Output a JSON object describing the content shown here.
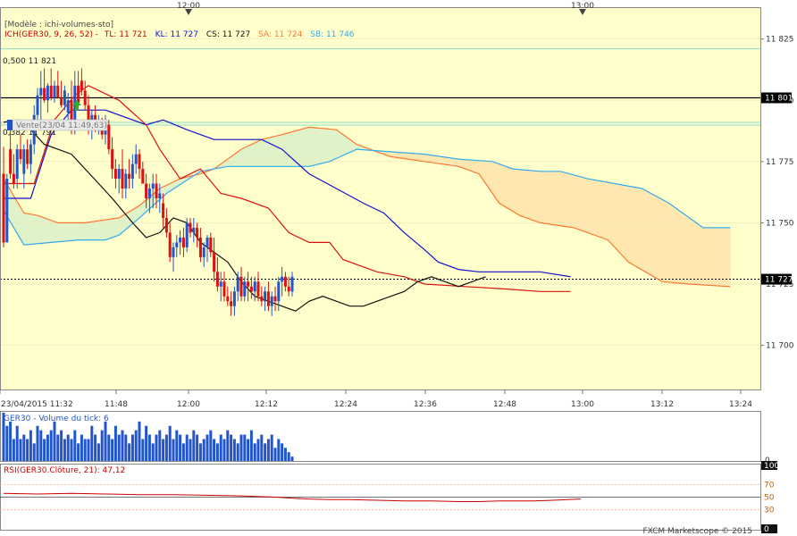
{
  "top_time_labels": [
    "12:00",
    "13:00"
  ],
  "header": {
    "model": "[Modèle : ichi-volumes-sto]",
    "ich_prefix": "ICH(GER30, 9, 26, 52) -",
    "tl": "TL: 11 721",
    "kl": "KL: 11 727",
    "cs": "CS: 11 727",
    "sa": "SA: 11 724",
    "sb": "SB: 11 746"
  },
  "annotations": {
    "fib_top": "0,500 11 821",
    "fib_mid": "0,382 11 791",
    "order": "Vente(23/04 11:49,63)"
  },
  "price_axis": {
    "ticks": [
      "11 825",
      "11 800",
      "11 775",
      "11 750",
      "11 725",
      "11 700"
    ],
    "tick_values": [
      11825,
      11800,
      11775,
      11750,
      11725,
      11700
    ],
    "level_label": "11 801",
    "current_label": "11 727"
  },
  "time_axis": {
    "labels": [
      "23/04/2015 11:32",
      "11:48",
      "12:00",
      "12:12",
      "12:24",
      "12:36",
      "12:48",
      "13:00",
      "13:12",
      "13:24"
    ]
  },
  "volume_panel": {
    "title": "GER30 - Volume du tick: 6",
    "axis_zero": "0"
  },
  "rsi_panel": {
    "title": "RSI(GER30.Clôture, 21): 47,12",
    "axis_ticks": [
      "100",
      "70",
      "50",
      "30",
      "0"
    ]
  },
  "footer": "FXCM Marketscope © 2015",
  "colors": {
    "background": "#ffffcc",
    "bull": "#2255cc",
    "bear": "#dd1111",
    "tenkan": "#dd1111",
    "kijun": "#1111cc",
    "senkou_a": "#ff7733",
    "senkou_b": "#33aaee",
    "chikou": "#111111",
    "cloud_bull": "#e0f2c8",
    "cloud_bear": "#ffe8b0",
    "fib": "#88ddcc",
    "rsi": "#cc0000"
  },
  "chart_data": {
    "type": "candlestick",
    "symbol": "GER30",
    "ylim": [
      11682,
      11838
    ],
    "levels": {
      "fib_0_500": 11821,
      "fib_0_382": 11791,
      "resistance": 11801,
      "current": 11727
    },
    "candles": [
      [
        11770,
        11781,
        11740,
        11742
      ],
      [
        11742,
        11770,
        11742,
        11768
      ],
      [
        11780,
        11788,
        11768,
        11770
      ],
      [
        11770,
        11778,
        11764,
        11766
      ],
      [
        11768,
        11782,
        11764,
        11780
      ],
      [
        11780,
        11786,
        11774,
        11776
      ],
      [
        11770,
        11782,
        11764,
        11780
      ],
      [
        11780,
        11784,
        11772,
        11774
      ],
      [
        11774,
        11784,
        11770,
        11782
      ],
      [
        11782,
        11798,
        11778,
        11794
      ],
      [
        11794,
        11805,
        11790,
        11802
      ],
      [
        11802,
        11812,
        11790,
        11805
      ],
      [
        11805,
        11813,
        11799,
        11800
      ],
      [
        11800,
        11807,
        11795,
        11806
      ],
      [
        11806,
        11813,
        11800,
        11801
      ],
      [
        11801,
        11808,
        11799,
        11806
      ],
      [
        11806,
        11812,
        11801,
        11801
      ],
      [
        11801,
        11808,
        11797,
        11798
      ],
      [
        11798,
        11806,
        11796,
        11804
      ],
      [
        11795,
        11803,
        11790,
        11800
      ],
      [
        11800,
        11808,
        11786,
        11790
      ],
      [
        11790,
        11812,
        11786,
        11806
      ],
      [
        11806,
        11812,
        11798,
        11799
      ],
      [
        11808,
        11813,
        11802,
        11804
      ],
      [
        11804,
        11808,
        11796,
        11798
      ],
      [
        11798,
        11802,
        11786,
        11788
      ],
      [
        11788,
        11796,
        11784,
        11794
      ],
      [
        11794,
        11798,
        11787,
        11790
      ],
      [
        11790,
        11794,
        11786,
        11790
      ],
      [
        11790,
        11793,
        11784,
        11786
      ],
      [
        11786,
        11794,
        11782,
        11790
      ],
      [
        11790,
        11792,
        11778,
        11780
      ],
      [
        11780,
        11785,
        11768,
        11772
      ],
      [
        11772,
        11776,
        11764,
        11768
      ],
      [
        11768,
        11774,
        11762,
        11772
      ],
      [
        11772,
        11780,
        11760,
        11764
      ],
      [
        11764,
        11772,
        11760,
        11770
      ],
      [
        11770,
        11776,
        11764,
        11768
      ],
      [
        11768,
        11778,
        11764,
        11774
      ],
      [
        11774,
        11782,
        11770,
        11778
      ],
      [
        11778,
        11780,
        11768,
        11772
      ],
      [
        11772,
        11775,
        11766,
        11766
      ],
      [
        11766,
        11770,
        11756,
        11760
      ],
      [
        11760,
        11766,
        11754,
        11764
      ],
      [
        11764,
        11770,
        11756,
        11766
      ],
      [
        11766,
        11770,
        11756,
        11760
      ],
      [
        11760,
        11766,
        11754,
        11762
      ],
      [
        11758,
        11762,
        11748,
        11752
      ],
      [
        11752,
        11756,
        11744,
        11746
      ],
      [
        11746,
        11750,
        11734,
        11736
      ],
      [
        11736,
        11742,
        11730,
        11740
      ],
      [
        11740,
        11745,
        11736,
        11742
      ],
      [
        11742,
        11747,
        11737,
        11744
      ],
      [
        11744,
        11748,
        11736,
        11740
      ],
      [
        11740,
        11752,
        11738,
        11750
      ],
      [
        11750,
        11752,
        11744,
        11746
      ],
      [
        11746,
        11752,
        11742,
        11748
      ],
      [
        11748,
        11750,
        11740,
        11744
      ],
      [
        11744,
        11748,
        11734,
        11736
      ],
      [
        11736,
        11742,
        11732,
        11740
      ],
      [
        11740,
        11745,
        11734,
        11744
      ],
      [
        11744,
        11746,
        11736,
        11738
      ],
      [
        11738,
        11744,
        11726,
        11730
      ],
      [
        11730,
        11736,
        11722,
        11724
      ],
      [
        11724,
        11730,
        11718,
        11726
      ],
      [
        11726,
        11730,
        11718,
        11720
      ],
      [
        11720,
        11724,
        11716,
        11718
      ],
      [
        11718,
        11722,
        11712,
        11716
      ],
      [
        11716,
        11724,
        11712,
        11722
      ],
      [
        11722,
        11730,
        11718,
        11728
      ],
      [
        11728,
        11732,
        11718,
        11720
      ],
      [
        11720,
        11728,
        11718,
        11726
      ],
      [
        11726,
        11730,
        11718,
        11724
      ],
      [
        11724,
        11728,
        11719,
        11722
      ],
      [
        11722,
        11728,
        11718,
        11726
      ],
      [
        11726,
        11730,
        11718,
        11720
      ],
      [
        11720,
        11724,
        11716,
        11718
      ],
      [
        11718,
        11724,
        11714,
        11722
      ],
      [
        11722,
        11726,
        11714,
        11716
      ],
      [
        11716,
        11722,
        11712,
        11720
      ],
      [
        11720,
        11724,
        11714,
        11718
      ],
      [
        11718,
        11728,
        11714,
        11726
      ],
      [
        11726,
        11732,
        11720,
        11728
      ],
      [
        11728,
        11730,
        11722,
        11724
      ],
      [
        11724,
        11728,
        11720,
        11722
      ],
      [
        11722,
        11730,
        11720,
        11728
      ]
    ],
    "tenkan": [
      [
        0,
        11766
      ],
      [
        9,
        11766
      ],
      [
        15,
        11792
      ],
      [
        21,
        11802
      ],
      [
        25,
        11806
      ],
      [
        34,
        11800
      ],
      [
        38,
        11795
      ],
      [
        42,
        11790
      ],
      [
        46,
        11780
      ],
      [
        52,
        11768
      ],
      [
        58,
        11772
      ],
      [
        64,
        11762
      ],
      [
        70,
        11760
      ],
      [
        78,
        11756
      ],
      [
        84,
        11746
      ],
      [
        90,
        11742
      ],
      [
        96,
        11742
      ],
      [
        100,
        11735
      ],
      [
        110,
        11730
      ],
      [
        118,
        11728
      ],
      [
        124,
        11725
      ],
      [
        136,
        11724
      ],
      [
        148,
        11723
      ],
      [
        158,
        11722
      ],
      [
        167,
        11722
      ]
    ],
    "kijun": [
      [
        0,
        11760
      ],
      [
        8,
        11760
      ],
      [
        14,
        11786
      ],
      [
        20,
        11796
      ],
      [
        30,
        11796
      ],
      [
        42,
        11790
      ],
      [
        47,
        11792
      ],
      [
        54,
        11788
      ],
      [
        62,
        11784
      ],
      [
        70,
        11784
      ],
      [
        76,
        11784
      ],
      [
        82,
        11780
      ],
      [
        90,
        11770
      ],
      [
        98,
        11764
      ],
      [
        106,
        11758
      ],
      [
        112,
        11754
      ],
      [
        118,
        11746
      ],
      [
        124,
        11739
      ],
      [
        128,
        11734
      ],
      [
        134,
        11731
      ],
      [
        140,
        11730
      ],
      [
        146,
        11730
      ],
      [
        158,
        11730
      ],
      [
        167,
        11728
      ]
    ],
    "senkou_a": [
      [
        0,
        11768
      ],
      [
        6,
        11754
      ],
      [
        10,
        11753
      ],
      [
        16,
        11750
      ],
      [
        24,
        11750
      ],
      [
        34,
        11752
      ],
      [
        40,
        11757
      ],
      [
        46,
        11764
      ],
      [
        52,
        11768
      ],
      [
        58,
        11770
      ],
      [
        62,
        11772
      ],
      [
        70,
        11780
      ],
      [
        76,
        11784
      ],
      [
        82,
        11786
      ],
      [
        90,
        11789
      ],
      [
        98,
        11788
      ],
      [
        104,
        11782
      ],
      [
        114,
        11777
      ],
      [
        124,
        11775
      ],
      [
        134,
        11773
      ],
      [
        140,
        11770
      ],
      [
        146,
        11758
      ],
      [
        152,
        11753
      ],
      [
        158,
        11750
      ],
      [
        168,
        11748
      ],
      [
        178,
        11743
      ],
      [
        184,
        11734
      ],
      [
        194,
        11726
      ],
      [
        202,
        11725
      ],
      [
        214,
        11724
      ]
    ],
    "senkou_b": [
      [
        0,
        11755
      ],
      [
        6,
        11741
      ],
      [
        14,
        11742
      ],
      [
        22,
        11743
      ],
      [
        30,
        11743
      ],
      [
        34,
        11745
      ],
      [
        40,
        11752
      ],
      [
        48,
        11762
      ],
      [
        58,
        11771
      ],
      [
        66,
        11773
      ],
      [
        78,
        11773
      ],
      [
        90,
        11773
      ],
      [
        96,
        11775
      ],
      [
        104,
        11780
      ],
      [
        114,
        11779
      ],
      [
        124,
        11778
      ],
      [
        134,
        11776
      ],
      [
        144,
        11775
      ],
      [
        150,
        11772
      ],
      [
        158,
        11771
      ],
      [
        164,
        11771
      ],
      [
        172,
        11768
      ],
      [
        180,
        11766
      ],
      [
        188,
        11764
      ],
      [
        196,
        11758
      ],
      [
        206,
        11748
      ],
      [
        214,
        11748
      ]
    ],
    "chikou": [
      [
        0,
        11791
      ],
      [
        4,
        11792
      ],
      [
        8,
        11788
      ],
      [
        12,
        11782
      ],
      [
        16,
        11780
      ],
      [
        20,
        11778
      ],
      [
        24,
        11772
      ],
      [
        28,
        11766
      ],
      [
        32,
        11760
      ],
      [
        38,
        11750
      ],
      [
        42,
        11744
      ],
      [
        46,
        11746
      ],
      [
        50,
        11752
      ],
      [
        54,
        11750
      ],
      [
        58,
        11742
      ],
      [
        62,
        11738
      ],
      [
        66,
        11734
      ],
      [
        70,
        11726
      ],
      [
        74,
        11720
      ],
      [
        78,
        11718
      ],
      [
        82,
        11716
      ],
      [
        86,
        11714
      ],
      [
        90,
        11718
      ],
      [
        94,
        11720
      ],
      [
        98,
        11718
      ],
      [
        102,
        11716
      ],
      [
        106,
        11716
      ],
      [
        110,
        11718
      ],
      [
        114,
        11720
      ],
      [
        118,
        11722
      ],
      [
        122,
        11726
      ],
      [
        126,
        11728
      ],
      [
        130,
        11726
      ],
      [
        134,
        11724
      ],
      [
        138,
        11726
      ],
      [
        142,
        11728
      ]
    ],
    "volume": [
      11,
      8,
      9,
      5,
      8,
      5,
      6,
      5,
      7,
      4,
      8,
      7,
      5,
      6,
      7,
      9,
      6,
      7,
      5,
      6,
      5,
      7,
      4,
      6,
      5,
      5,
      8,
      6,
      4,
      7,
      9,
      6,
      5,
      8,
      6,
      7,
      6,
      4,
      6,
      7,
      9,
      5,
      8,
      6,
      4,
      6,
      7,
      5,
      6,
      8,
      5,
      7,
      6,
      4,
      6,
      5,
      7,
      6,
      4,
      5,
      6,
      7,
      5,
      4,
      6,
      5,
      7,
      6,
      5,
      4,
      6,
      6,
      5,
      7,
      4,
      5,
      6,
      4,
      5,
      6,
      3,
      5,
      4,
      3,
      2,
      1
    ],
    "rsi": [
      [
        0,
        56
      ],
      [
        10,
        55
      ],
      [
        20,
        56
      ],
      [
        30,
        55
      ],
      [
        40,
        54
      ],
      [
        50,
        54
      ],
      [
        60,
        53
      ],
      [
        70,
        52
      ],
      [
        80,
        50
      ],
      [
        86,
        48
      ],
      [
        90,
        47
      ],
      [
        96,
        46
      ],
      [
        102,
        46
      ],
      [
        110,
        45
      ],
      [
        118,
        44
      ],
      [
        126,
        44
      ],
      [
        134,
        43
      ],
      [
        140,
        43
      ],
      [
        146,
        44
      ],
      [
        152,
        44
      ],
      [
        156,
        44
      ],
      [
        162,
        45
      ],
      [
        166,
        46
      ],
      [
        170,
        47
      ]
    ]
  }
}
